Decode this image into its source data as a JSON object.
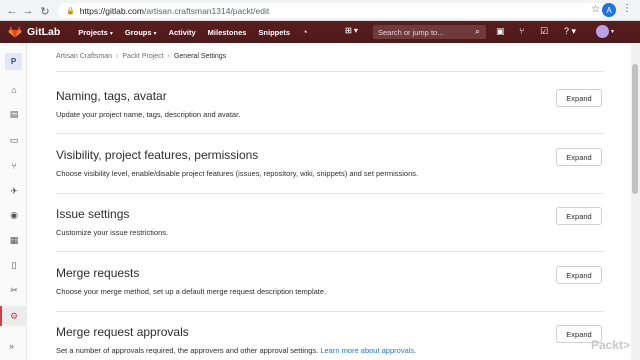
{
  "browser": {
    "url_host": "https://gitlab.com",
    "url_path": "/artisan.craftsman1314/packt/edit",
    "profile_initial": "A"
  },
  "topnav": {
    "brand": "GitLab",
    "menu": [
      {
        "label": "Projects",
        "dropdown": true
      },
      {
        "label": "Groups",
        "dropdown": true
      },
      {
        "label": "Activity",
        "dropdown": false
      },
      {
        "label": "Milestones",
        "dropdown": false
      },
      {
        "label": "Snippets",
        "dropdown": false
      }
    ],
    "search_placeholder": "Search or jump to..."
  },
  "sidebar": {
    "project_initial": "P"
  },
  "breadcrumb": [
    "Artisan Craftsman",
    "Packt Project",
    "General Settings"
  ],
  "sections": [
    {
      "title": "Naming, tags, avatar",
      "desc": "Update your project name, tags, description and avatar.",
      "button": "Expand"
    },
    {
      "title": "Visibility, project features, permissions",
      "desc": "Choose visibility level, enable/disable project features (issues, repository, wiki, snippets) and set permissions.",
      "button": "Expand"
    },
    {
      "title": "Issue settings",
      "desc": "Customize your issue restrictions.",
      "button": "Expand"
    },
    {
      "title": "Merge requests",
      "desc": "Choose your merge method, set up a default merge request description template.",
      "button": "Expand"
    },
    {
      "title": "Merge request approvals",
      "desc": "Set a number of approvals required, the approvers and other approval settings.",
      "link": "Learn more about approvals.",
      "button": "Expand"
    }
  ],
  "watermark": "Packt>",
  "colors": {
    "accent": "#c9443e",
    "nav_bg": "#531c1c",
    "link": "#1f78d1"
  }
}
